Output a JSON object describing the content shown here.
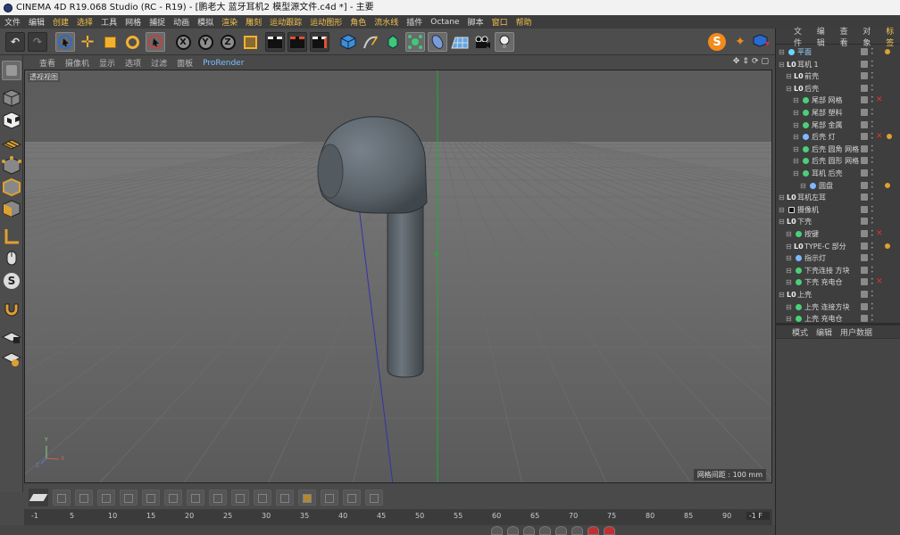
{
  "window": {
    "title": "CINEMA 4D R19.068 Studio (RC - R19) - [鹏老大 蓝牙耳机2 模型源文件.c4d *] - 主要"
  },
  "menu": [
    "文件",
    "编辑",
    "创建",
    "选择",
    "工具",
    "网格",
    "捕捉",
    "动画",
    "模拟",
    "渲染",
    "雕刻",
    "运动跟踪",
    "运动图形",
    "角色",
    "流水线",
    "插件",
    "Octane",
    "脚本",
    "窗口",
    "帮助"
  ],
  "viewport": {
    "menu": [
      "查看",
      "摄像机",
      "显示",
      "选项",
      "过滤",
      "面板",
      "ProRender"
    ],
    "active_menu": "ProRender",
    "label": "透视视图",
    "grid_info": "网格间距 : 100 mm",
    "axis_labels": {
      "y": "Y",
      "x": "X",
      "z": "Z"
    }
  },
  "toolbar": {
    "axis_x": "X",
    "axis_y": "Y",
    "axis_z": "Z"
  },
  "object_manager": {
    "tabs": [
      "文件",
      "编辑",
      "查看",
      "对象",
      "标签"
    ],
    "active_tab": "标签",
    "rows": [
      {
        "label": "平面",
        "indent": 0,
        "icon": "#6ad5ff"
      },
      {
        "label": "耳机 1",
        "indent": 0,
        "icon": "null"
      },
      {
        "label": "前壳",
        "indent": 1,
        "icon": "null"
      },
      {
        "label": "后壳",
        "indent": 1,
        "icon": "null"
      },
      {
        "label": "尾部 网格",
        "indent": 2,
        "icon": "#4ad07a",
        "x": true
      },
      {
        "label": "尾部 塑料",
        "indent": 2,
        "icon": "#4ad07a"
      },
      {
        "label": "尾部 金属",
        "indent": 2,
        "icon": "#4ad07a"
      },
      {
        "label": "后壳 灯",
        "indent": 2,
        "icon": "#7fb8ff",
        "x": true
      },
      {
        "label": "后壳 圆角 网格",
        "indent": 2,
        "icon": "#4ad07a"
      },
      {
        "label": "后壳 圆形 网格",
        "indent": 2,
        "icon": "#4ad07a"
      },
      {
        "label": "耳机 后壳",
        "indent": 2,
        "icon": "#4ad07a"
      },
      {
        "label": "圆盘",
        "indent": 3,
        "icon": "#7fb8ff"
      },
      {
        "label": "耳机左耳",
        "indent": 0,
        "icon": "null"
      },
      {
        "label": "摄像机",
        "indent": 0,
        "icon": "camera"
      },
      {
        "label": "下壳",
        "indent": 0,
        "icon": "null"
      },
      {
        "label": "按键",
        "indent": 1,
        "icon": "#4ad07a",
        "x": true
      },
      {
        "label": "TYPE-C 部分",
        "indent": 1,
        "icon": "null"
      },
      {
        "label": "指示灯",
        "indent": 1,
        "icon": "#7fb8ff"
      },
      {
        "label": "下壳连接 方块",
        "indent": 1,
        "icon": "#4ad07a"
      },
      {
        "label": "下壳 充电仓",
        "indent": 1,
        "icon": "#4ad07a",
        "x": true
      },
      {
        "label": "上壳",
        "indent": 0,
        "icon": "null"
      },
      {
        "label": "上壳 连接方块",
        "indent": 1,
        "icon": "#4ad07a"
      },
      {
        "label": "上壳 充电仓",
        "indent": 1,
        "icon": "#4ad07a"
      }
    ]
  },
  "attributes": {
    "tabs": [
      "模式",
      "编辑",
      "用户数据"
    ]
  },
  "timeline": {
    "ticks": [
      "-1",
      "5",
      "10",
      "15",
      "20",
      "25",
      "30",
      "35",
      "40",
      "45",
      "50",
      "55",
      "60",
      "65",
      "70",
      "75",
      "80",
      "85",
      "90"
    ],
    "frame_readout": "-1 F"
  },
  "colors": {
    "accent": "#f2c14e",
    "viewport_bg": "#5a5a5a"
  }
}
